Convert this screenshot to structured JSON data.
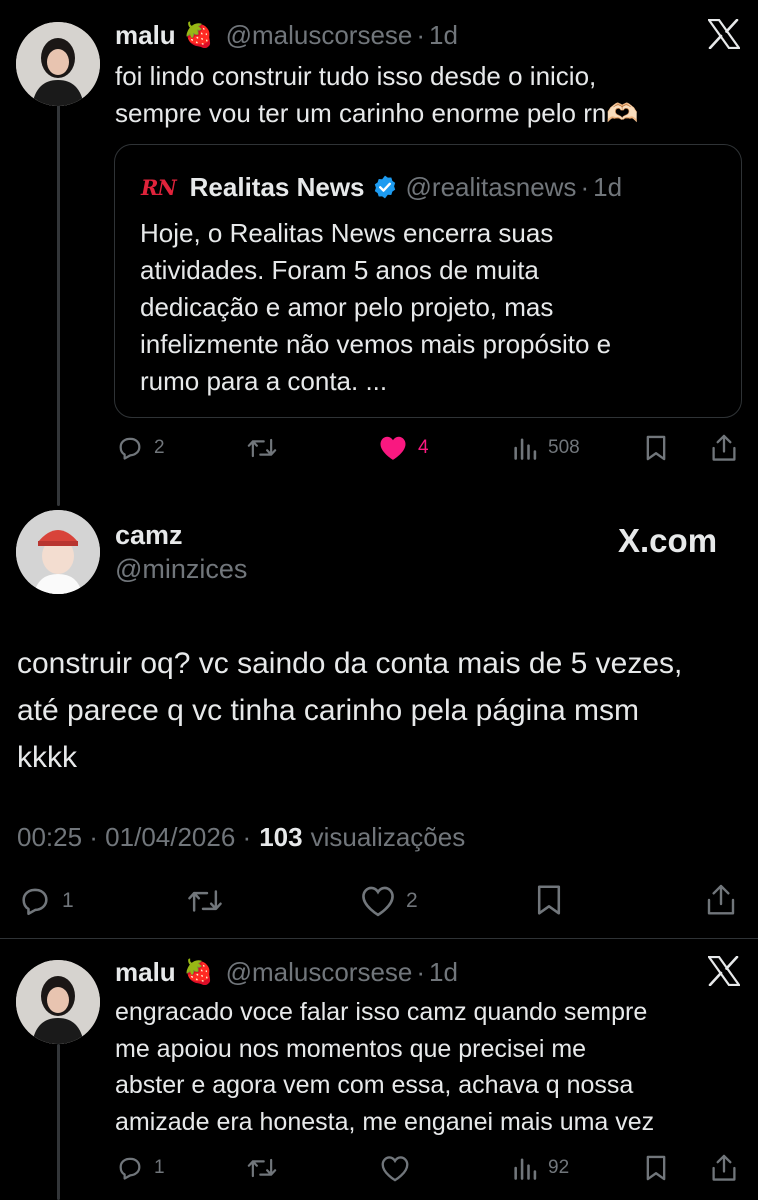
{
  "tweet1": {
    "name": "malu",
    "emoji": "🍓",
    "handle": "@maluscorsese",
    "sep": "·",
    "time": "1d",
    "text_line1": "foi lindo construir tudo isso desde o inicio,",
    "text_line2": "sempre vou ter um carinho enorme pelo rn🫶🏻",
    "quote": {
      "logo": "RN",
      "name": "Realitas News",
      "handle": "@realitasnews",
      "sep": "·",
      "time": "1d",
      "lines": [
        "Hoje, o Realitas News encerra suas",
        "atividades. Foram 5 anos de muita",
        "dedicação e amor pelo projeto, mas",
        "infelizmente não vemos mais propósito e",
        "rumo para a conta. ..."
      ]
    },
    "replies": "2",
    "likes": "4",
    "views": "508"
  },
  "tweet2": {
    "name": "camz",
    "handle": "@minzices",
    "brand": "X.com",
    "lines": [
      "construir oq? vc saindo da conta mais de 5 vezes,",
      "até parece q vc tinha carinho pela página msm",
      "kkkk"
    ],
    "meta_time": "00:25 · 01/04/2026 ·",
    "meta_views_count": "103",
    "meta_views_label": "visualizações",
    "replies": "1",
    "likes": "2"
  },
  "tweet3": {
    "name": "malu",
    "emoji": "🍓",
    "handle": "@maluscorsese",
    "sep": "·",
    "time": "1d",
    "lines": [
      "engracado voce falar isso camz quando sempre",
      "me apoiou nos momentos que precisei me",
      "abster e agora vem com essa, achava q nossa",
      "amizade era honesta, me enganei mais uma vez"
    ],
    "replies": "1",
    "views": "92"
  },
  "colors": {
    "background": "#000000",
    "text": "#e7e9ea",
    "muted": "#71767b",
    "like": "#f91880",
    "verified": "#1d9bf0",
    "rn_logo": "#e0233b"
  },
  "icons": [
    "x-logo",
    "reply-icon",
    "retweet-icon",
    "like-icon",
    "views-icon",
    "bookmark-icon",
    "share-icon",
    "verified-badge-icon"
  ]
}
